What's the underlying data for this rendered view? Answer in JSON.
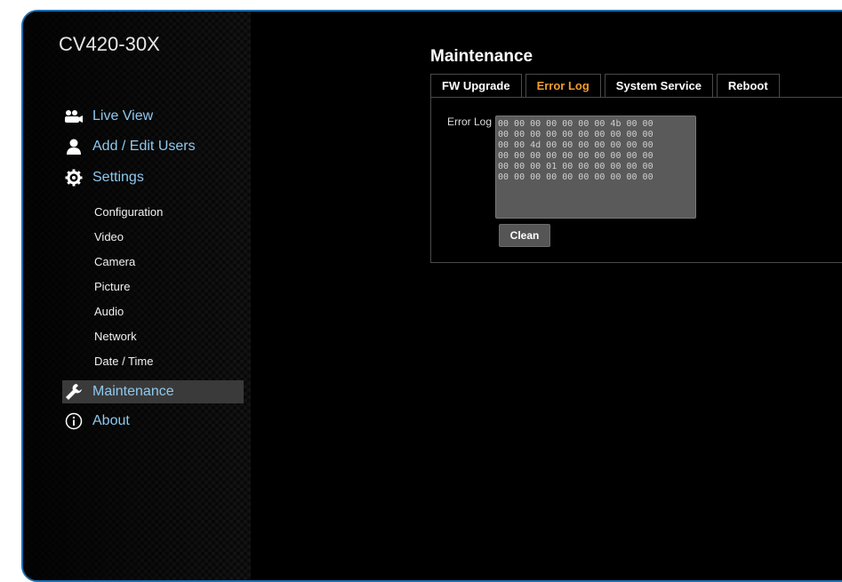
{
  "device": {
    "name": "CV420-30X"
  },
  "nav": {
    "main": [
      {
        "label": "Live View",
        "icon": "users-camera-icon"
      },
      {
        "label": "Add / Edit Users",
        "icon": "user-icon"
      },
      {
        "label": "Settings",
        "icon": "gear-icon"
      }
    ],
    "sub": [
      "Configuration",
      "Video",
      "Camera",
      "Picture",
      "Audio",
      "Network",
      "Date / Time"
    ],
    "maintenance": {
      "label": "Maintenance",
      "icon": "wrench-icon",
      "active": true
    },
    "about": {
      "label": "About",
      "icon": "info-icon"
    }
  },
  "page": {
    "title": "Maintenance",
    "tabs": [
      {
        "label": "FW Upgrade",
        "active": false
      },
      {
        "label": "Error Log",
        "active": true
      },
      {
        "label": "System Service",
        "active": false
      },
      {
        "label": "Reboot",
        "active": false
      }
    ]
  },
  "error_log": {
    "label": "Error Log",
    "lines": [
      "00 00 00 00 00 00 00 4b 00 00",
      "00 00 00 00 00 00 00 00 00 00",
      "00 00 4d 00 00 00 00 00 00 00",
      "00 00 00 00 00 00 00 00 00 00",
      "00 00 00 01 00 00 00 00 00 00",
      "00 00 00 00 00 00 00 00 00 00"
    ],
    "clean_label": "Clean"
  },
  "colors": {
    "accent_link": "#8ec9ef",
    "active_tab": "#f29b2c",
    "frame_border": "#1f6fb0"
  }
}
